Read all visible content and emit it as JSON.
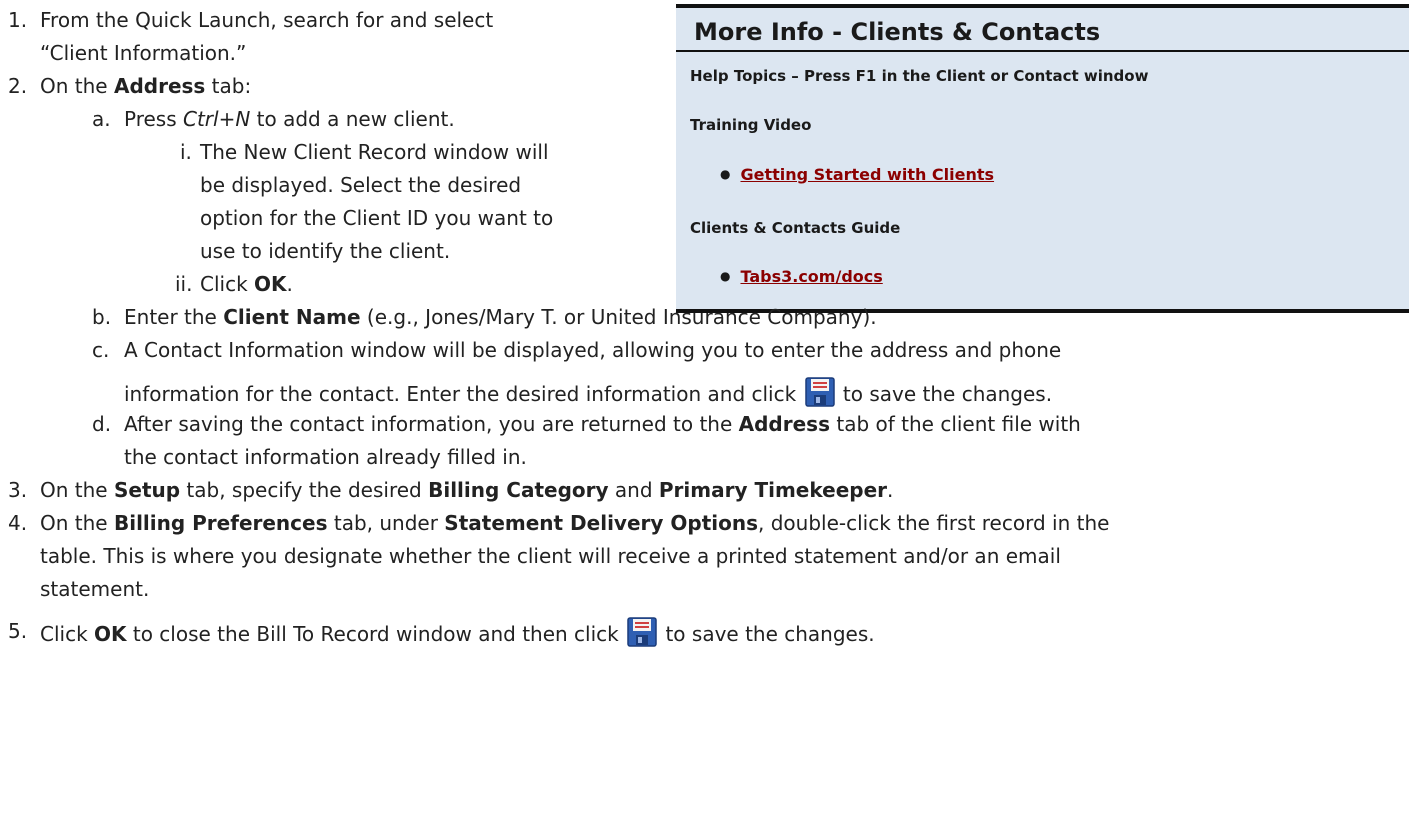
{
  "info_box": {
    "title": "More Info - Clients & Contacts",
    "help_topics": "Help Topics – Press F1 in the Client or Contact window",
    "training_video_heading": "Training Video",
    "training_video_link": "Getting Started with Clients",
    "guide_heading": "Clients & Contacts Guide",
    "guide_link": "Tabs3.com/docs"
  },
  "icons": {
    "save": "floppy-disk-save-icon"
  },
  "steps": {
    "s1": {
      "num": "1.",
      "line1": "From the Quick Launch, search for and select",
      "line2": "“Client Information.”"
    },
    "s2": {
      "num": "2.",
      "pre": "On the ",
      "tab": "Address",
      "post": " tab:",
      "a": {
        "num": "a.",
        "pre": "Press ",
        "key": "Ctrl+N",
        "post": " to add a new client."
      },
      "i": {
        "num": "i.",
        "l1": "The New Client Record window will",
        "l2": "be displayed. Select the desired",
        "l3": "option for the Client ID you want to",
        "l4": "use to identify the client."
      },
      "ii": {
        "num": "ii.",
        "pre": "Click ",
        "ok": "OK",
        "post": "."
      },
      "b": {
        "num": "b.",
        "pre": "Enter the ",
        "field": "Client Name",
        "post": " (e.g., Jones/Mary T. or United Insurance Company)."
      },
      "c": {
        "num": "c.",
        "l1": "A Contact Information window will be displayed, allowing you to enter the address and phone",
        "l2_pre": "information for the contact. Enter the desired information and click ",
        "l2_post": " to save the changes."
      },
      "d": {
        "num": "d.",
        "l1_pre": "After saving the contact information, you are returned to the ",
        "l1_tab": "Address",
        "l1_post": " tab of the client file with",
        "l2": "the contact information already filled in."
      }
    },
    "s3": {
      "num": "3.",
      "pre": "On the ",
      "tab": "Setup",
      "mid": " tab, specify the desired ",
      "f1": "Billing Category",
      "and": " and ",
      "f2": "Primary Timekeeper",
      "post": "."
    },
    "s4": {
      "num": "4.",
      "pre": "On the ",
      "tab": "Billing Preferences",
      "mid": " tab, under ",
      "section": "Statement Delivery Options",
      "post": ", double-click the first record in the",
      "l2": "table. This is where you designate whether the client will receive a printed statement and/or an email",
      "l3": "statement."
    },
    "s5": {
      "num": "5.",
      "pre": "Click ",
      "ok": "OK",
      "mid": " to close the Bill To Record window and then click ",
      "post": " to save the changes."
    }
  }
}
